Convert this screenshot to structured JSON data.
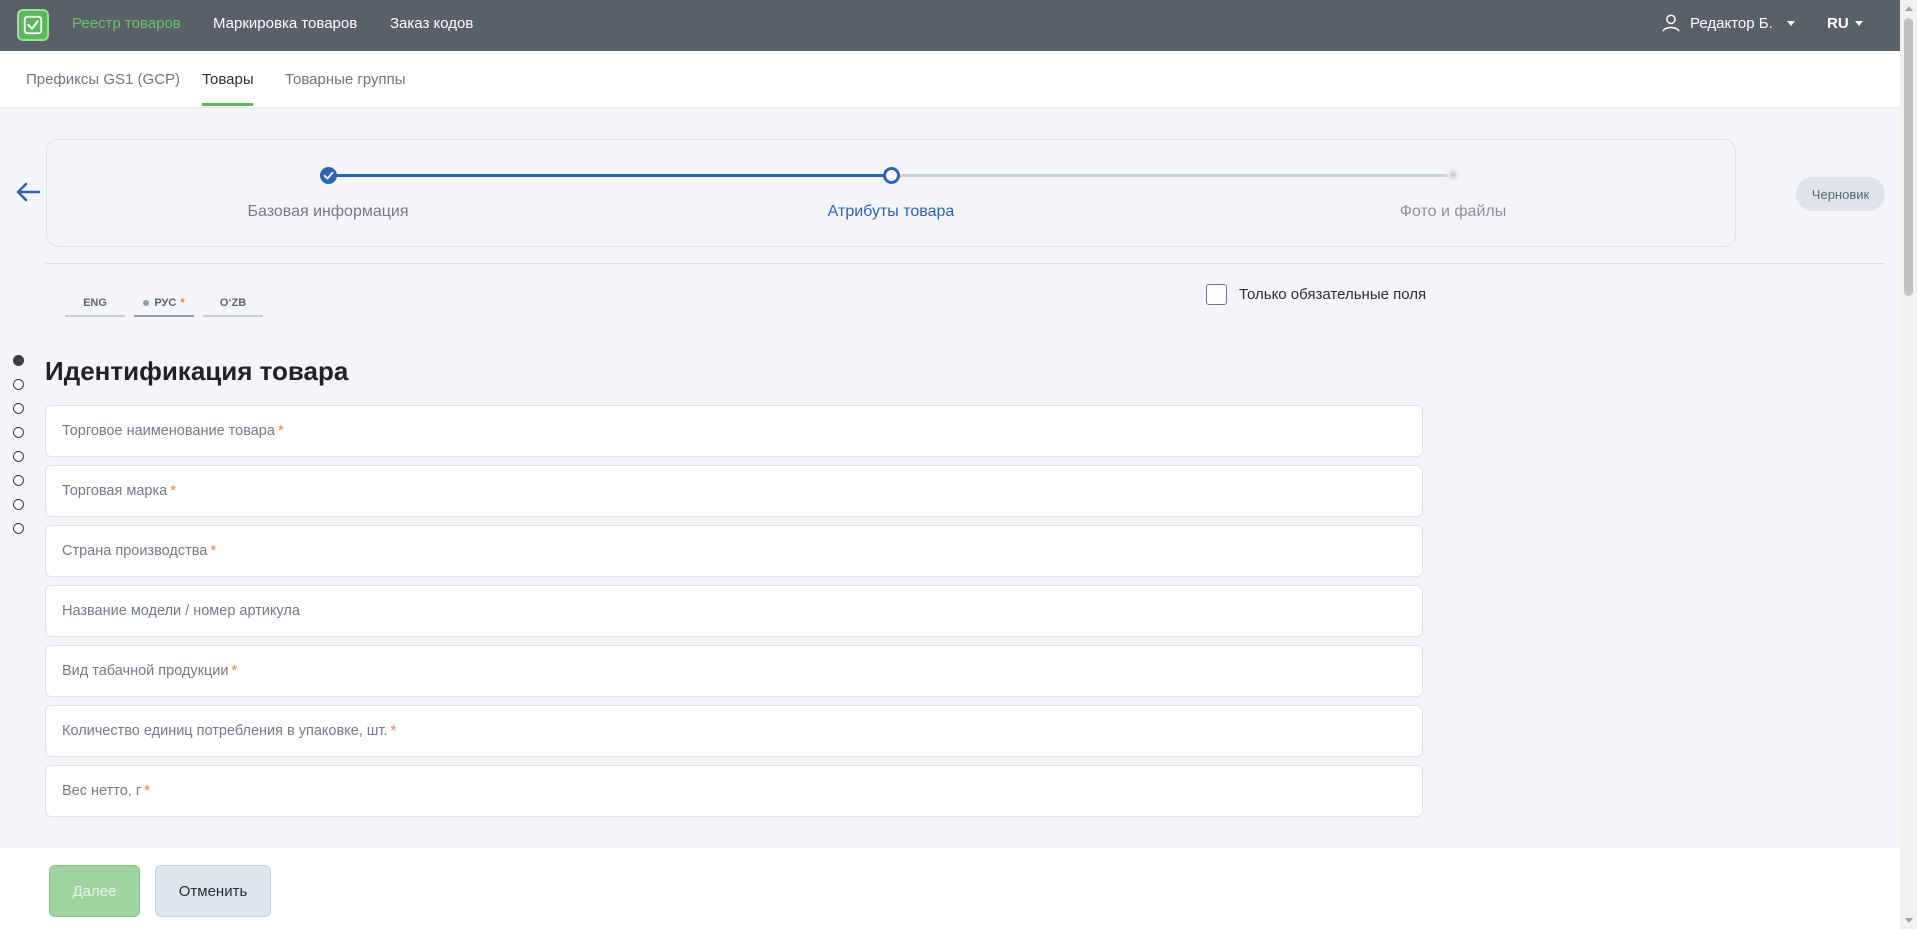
{
  "nav": {
    "items": [
      {
        "label": "Реестр товаров",
        "active": true
      },
      {
        "label": "Маркировка товаров",
        "active": false
      },
      {
        "label": "Заказ кодов",
        "active": false
      }
    ],
    "user": "Редактор Б.",
    "language": "RU"
  },
  "subtabs": [
    {
      "label": "Префиксы GS1 (GCP)"
    },
    {
      "label": "Товары",
      "active": true
    },
    {
      "label": "Товарные группы"
    }
  ],
  "stepper": {
    "steps": [
      {
        "label": "Базовая информация",
        "state": "done"
      },
      {
        "label": "Атрибуты товара",
        "state": "current"
      },
      {
        "label": "Фото и файлы",
        "state": "pending"
      }
    ],
    "status_badge": "Черновик"
  },
  "lang_tabs": [
    {
      "label": "ENG"
    },
    {
      "label": "РУС",
      "active": true,
      "required_mark": "*"
    },
    {
      "label": "O‘ZB"
    }
  ],
  "required_only_label": "Только обязательные поля",
  "section": {
    "title": "Идентификация товара",
    "fields": [
      {
        "label": "Торговое наименование товара",
        "required": "*"
      },
      {
        "label": "Торговая марка",
        "required": "*"
      },
      {
        "label": "Страна производства",
        "required": "*"
      },
      {
        "label": "Название модели / номер артикула",
        "required": ""
      },
      {
        "label": "Вид табачной продукции",
        "required": "*"
      },
      {
        "label": "Количество единиц потребления в упаковке, шт.",
        "required": "*"
      },
      {
        "label": "Вес нетто, г",
        "required": "*"
      }
    ]
  },
  "footer": {
    "next_label": "Далее",
    "cancel_label": "Отменить"
  },
  "colors": {
    "accent_green": "#5cb85c",
    "stepper_blue": "#2d64b8",
    "required_orange": "#f07a45",
    "topbar_bg": "#5a6068"
  }
}
